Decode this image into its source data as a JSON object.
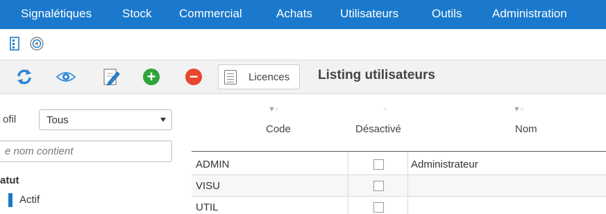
{
  "menu": {
    "items": [
      "Signalétiques",
      "Stock",
      "Commercial",
      "Achats",
      "Utilisateurs",
      "Outils",
      "Administration"
    ]
  },
  "strip": {
    "icons": [
      "grid-icon",
      "globe-icon"
    ]
  },
  "toolbar": {
    "buttons": [
      "refresh-icon",
      "eye-icon",
      "edit-icon",
      "add-icon",
      "remove-icon"
    ],
    "licences_label": "Licences",
    "page_title": "Listing utilisateurs",
    "colors": {
      "add": "#2ea43a",
      "remove": "#e8462f",
      "accent": "#1a79cc"
    }
  },
  "filters": {
    "profil_label": "ofil",
    "profil_value": "Tous",
    "name_placeholder": "e nom contient",
    "statut_label": "atut",
    "statut_option": "Actif"
  },
  "table": {
    "columns": [
      {
        "filter": "▼◦",
        "label": "Code"
      },
      {
        "filter": "◦",
        "label": "Désactivé"
      },
      {
        "filter": "▼◦",
        "label": "Nom"
      }
    ],
    "rows": [
      {
        "code": "ADMIN",
        "desactive": false,
        "nom": "Administrateur"
      },
      {
        "code": "VISU",
        "desactive": false,
        "nom": ""
      },
      {
        "code": "UTIL",
        "desactive": false,
        "nom": ""
      }
    ]
  }
}
